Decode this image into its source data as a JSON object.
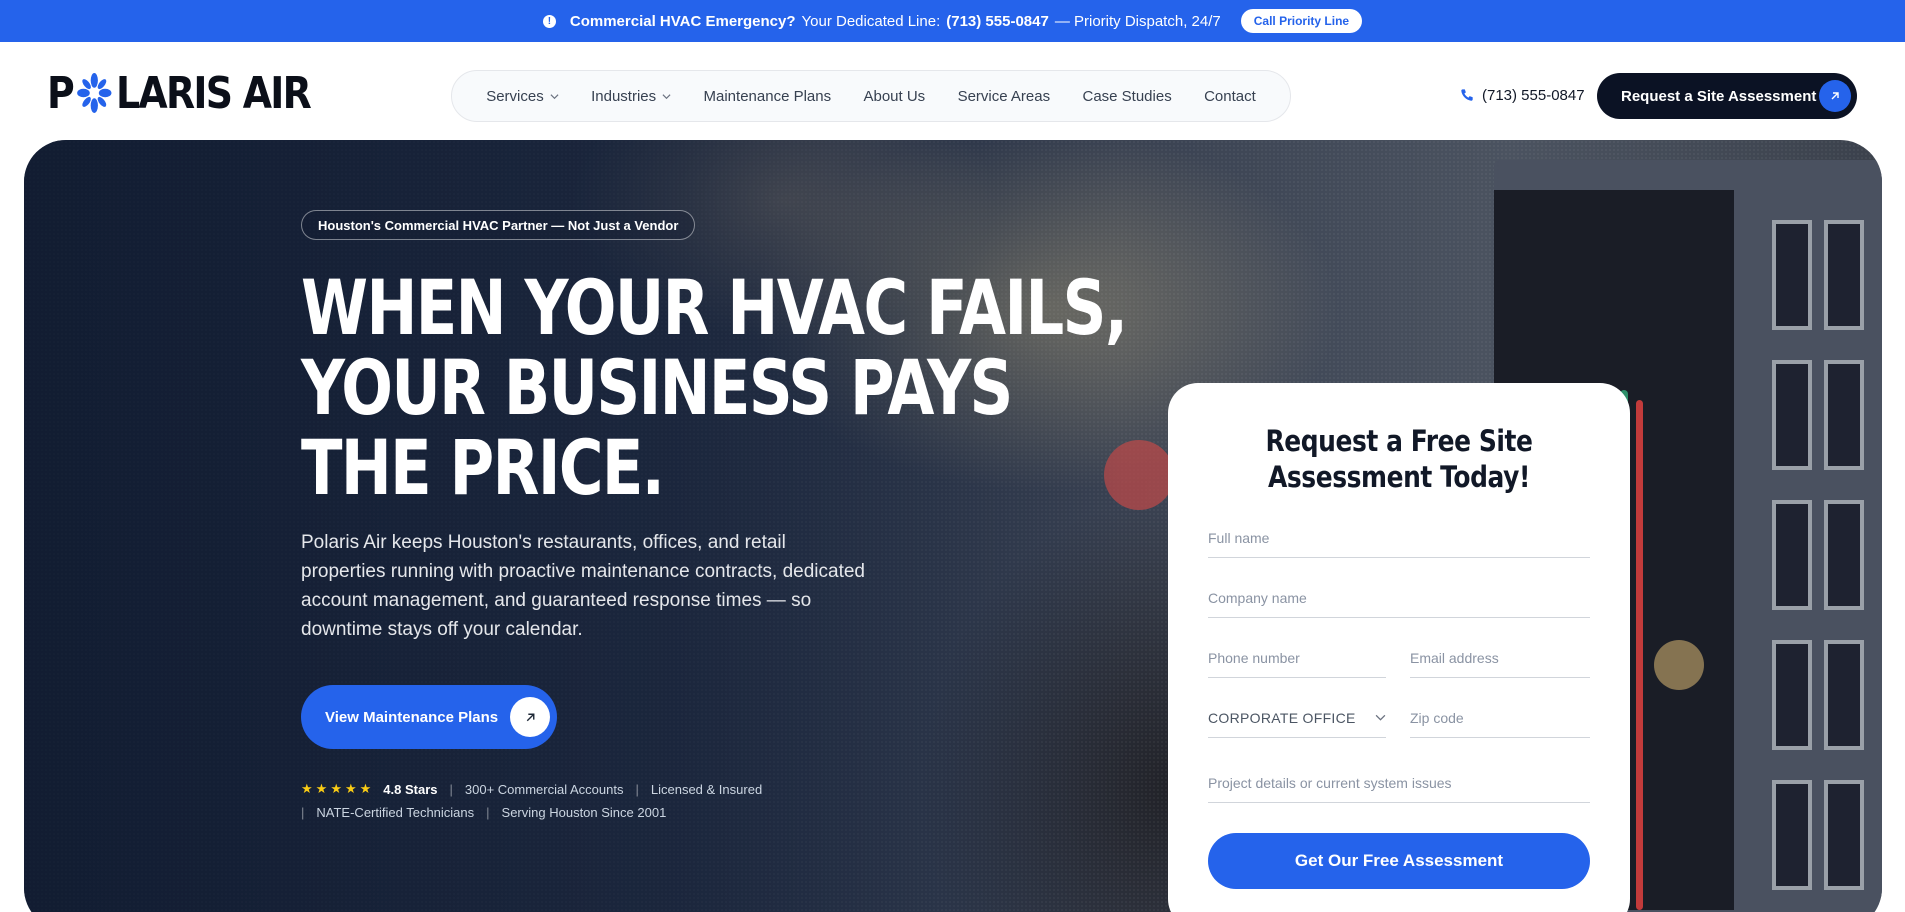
{
  "topbar": {
    "emergency": "Commercial HVAC Emergency?",
    "line_label": "Your Dedicated Line:",
    "phone": "(713) 555-0847",
    "dispatch": "— Priority Dispatch, 24/7",
    "button": "Call Priority Line"
  },
  "logo": {
    "left": "P",
    "right": "LARIS AIR"
  },
  "nav": {
    "items": [
      {
        "label": "Services"
      },
      {
        "label": "Industries"
      },
      {
        "label": "Maintenance Plans"
      },
      {
        "label": "About Us"
      },
      {
        "label": "Service Areas"
      },
      {
        "label": "Case Studies"
      },
      {
        "label": "Contact"
      }
    ]
  },
  "header": {
    "phone": "(713) 555-0847",
    "cta": "Request a Site Assessment"
  },
  "hero": {
    "tag": "Houston's Commercial HVAC Partner — Not Just a Vendor",
    "headline": [
      "WHEN YOUR HVAC FAILS,",
      "YOUR BUSINESS PAYS",
      "THE PRICE."
    ],
    "lead": "Polaris Air keeps Houston's restaurants, offices, and retail properties running with proactive maintenance contracts, dedicated account management, and guaranteed response times — so downtime stays off your calendar.",
    "button": "View Maintenance Plans",
    "rating": "4.8 Stars",
    "trust": [
      "300+ Commercial Accounts",
      "Licensed & Insured",
      "NATE-Certified Technicians",
      "Serving Houston Since 2001"
    ]
  },
  "form": {
    "title": "Request a Free Site Assessment Today!",
    "full_name": "Full name",
    "company": "Company name",
    "phone": "Phone number",
    "email": "Email address",
    "property_type": "CORPORATE OFFICE",
    "zip": "Zip code",
    "details": "Project details or current system issues",
    "submit": "Get Our Free Assessment"
  },
  "colors": {
    "accent": "#2563eb",
    "dark": "#0b1224",
    "star": "#facc15"
  }
}
